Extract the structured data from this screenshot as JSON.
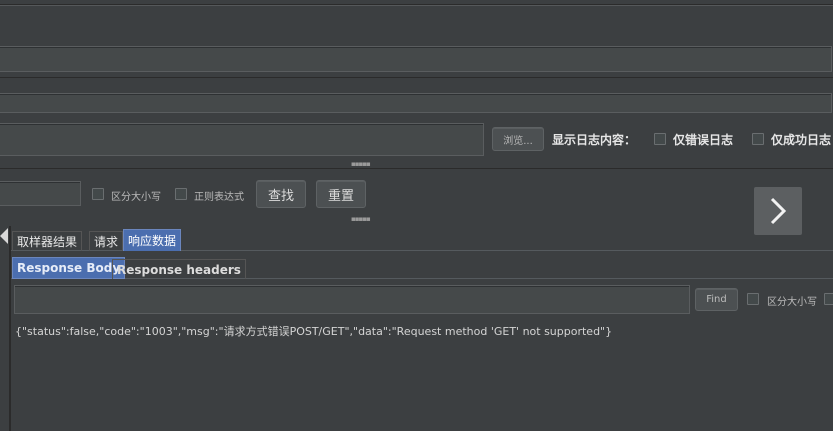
{
  "file_row": {
    "browse_label": "浏览...",
    "log_content_label": "显示日志内容：",
    "errors_only_label": "仅错误日志",
    "success_only_label": "仅成功日志"
  },
  "search_row": {
    "case_sensitive_label": "区分大小写",
    "regex_label": "正则表达式",
    "find_label": "查找",
    "reset_label": "重置"
  },
  "result_tabs": [
    "取样器结果",
    "请求",
    "响应数据"
  ],
  "response_tabs": [
    "Response Body",
    "Response headers"
  ],
  "body_search": {
    "find_label": "Find",
    "case_sensitive_label": "区分大小写"
  },
  "response_text": "{\"status\":false,\"code\":\"1003\",\"msg\":\"请求方式错误POST/GET\",\"data\":\"Request method 'GET' not supported\"}",
  "colors": {
    "background": "#3c3f41",
    "selected_tab": "#4b6eaf",
    "field": "#45494a"
  }
}
